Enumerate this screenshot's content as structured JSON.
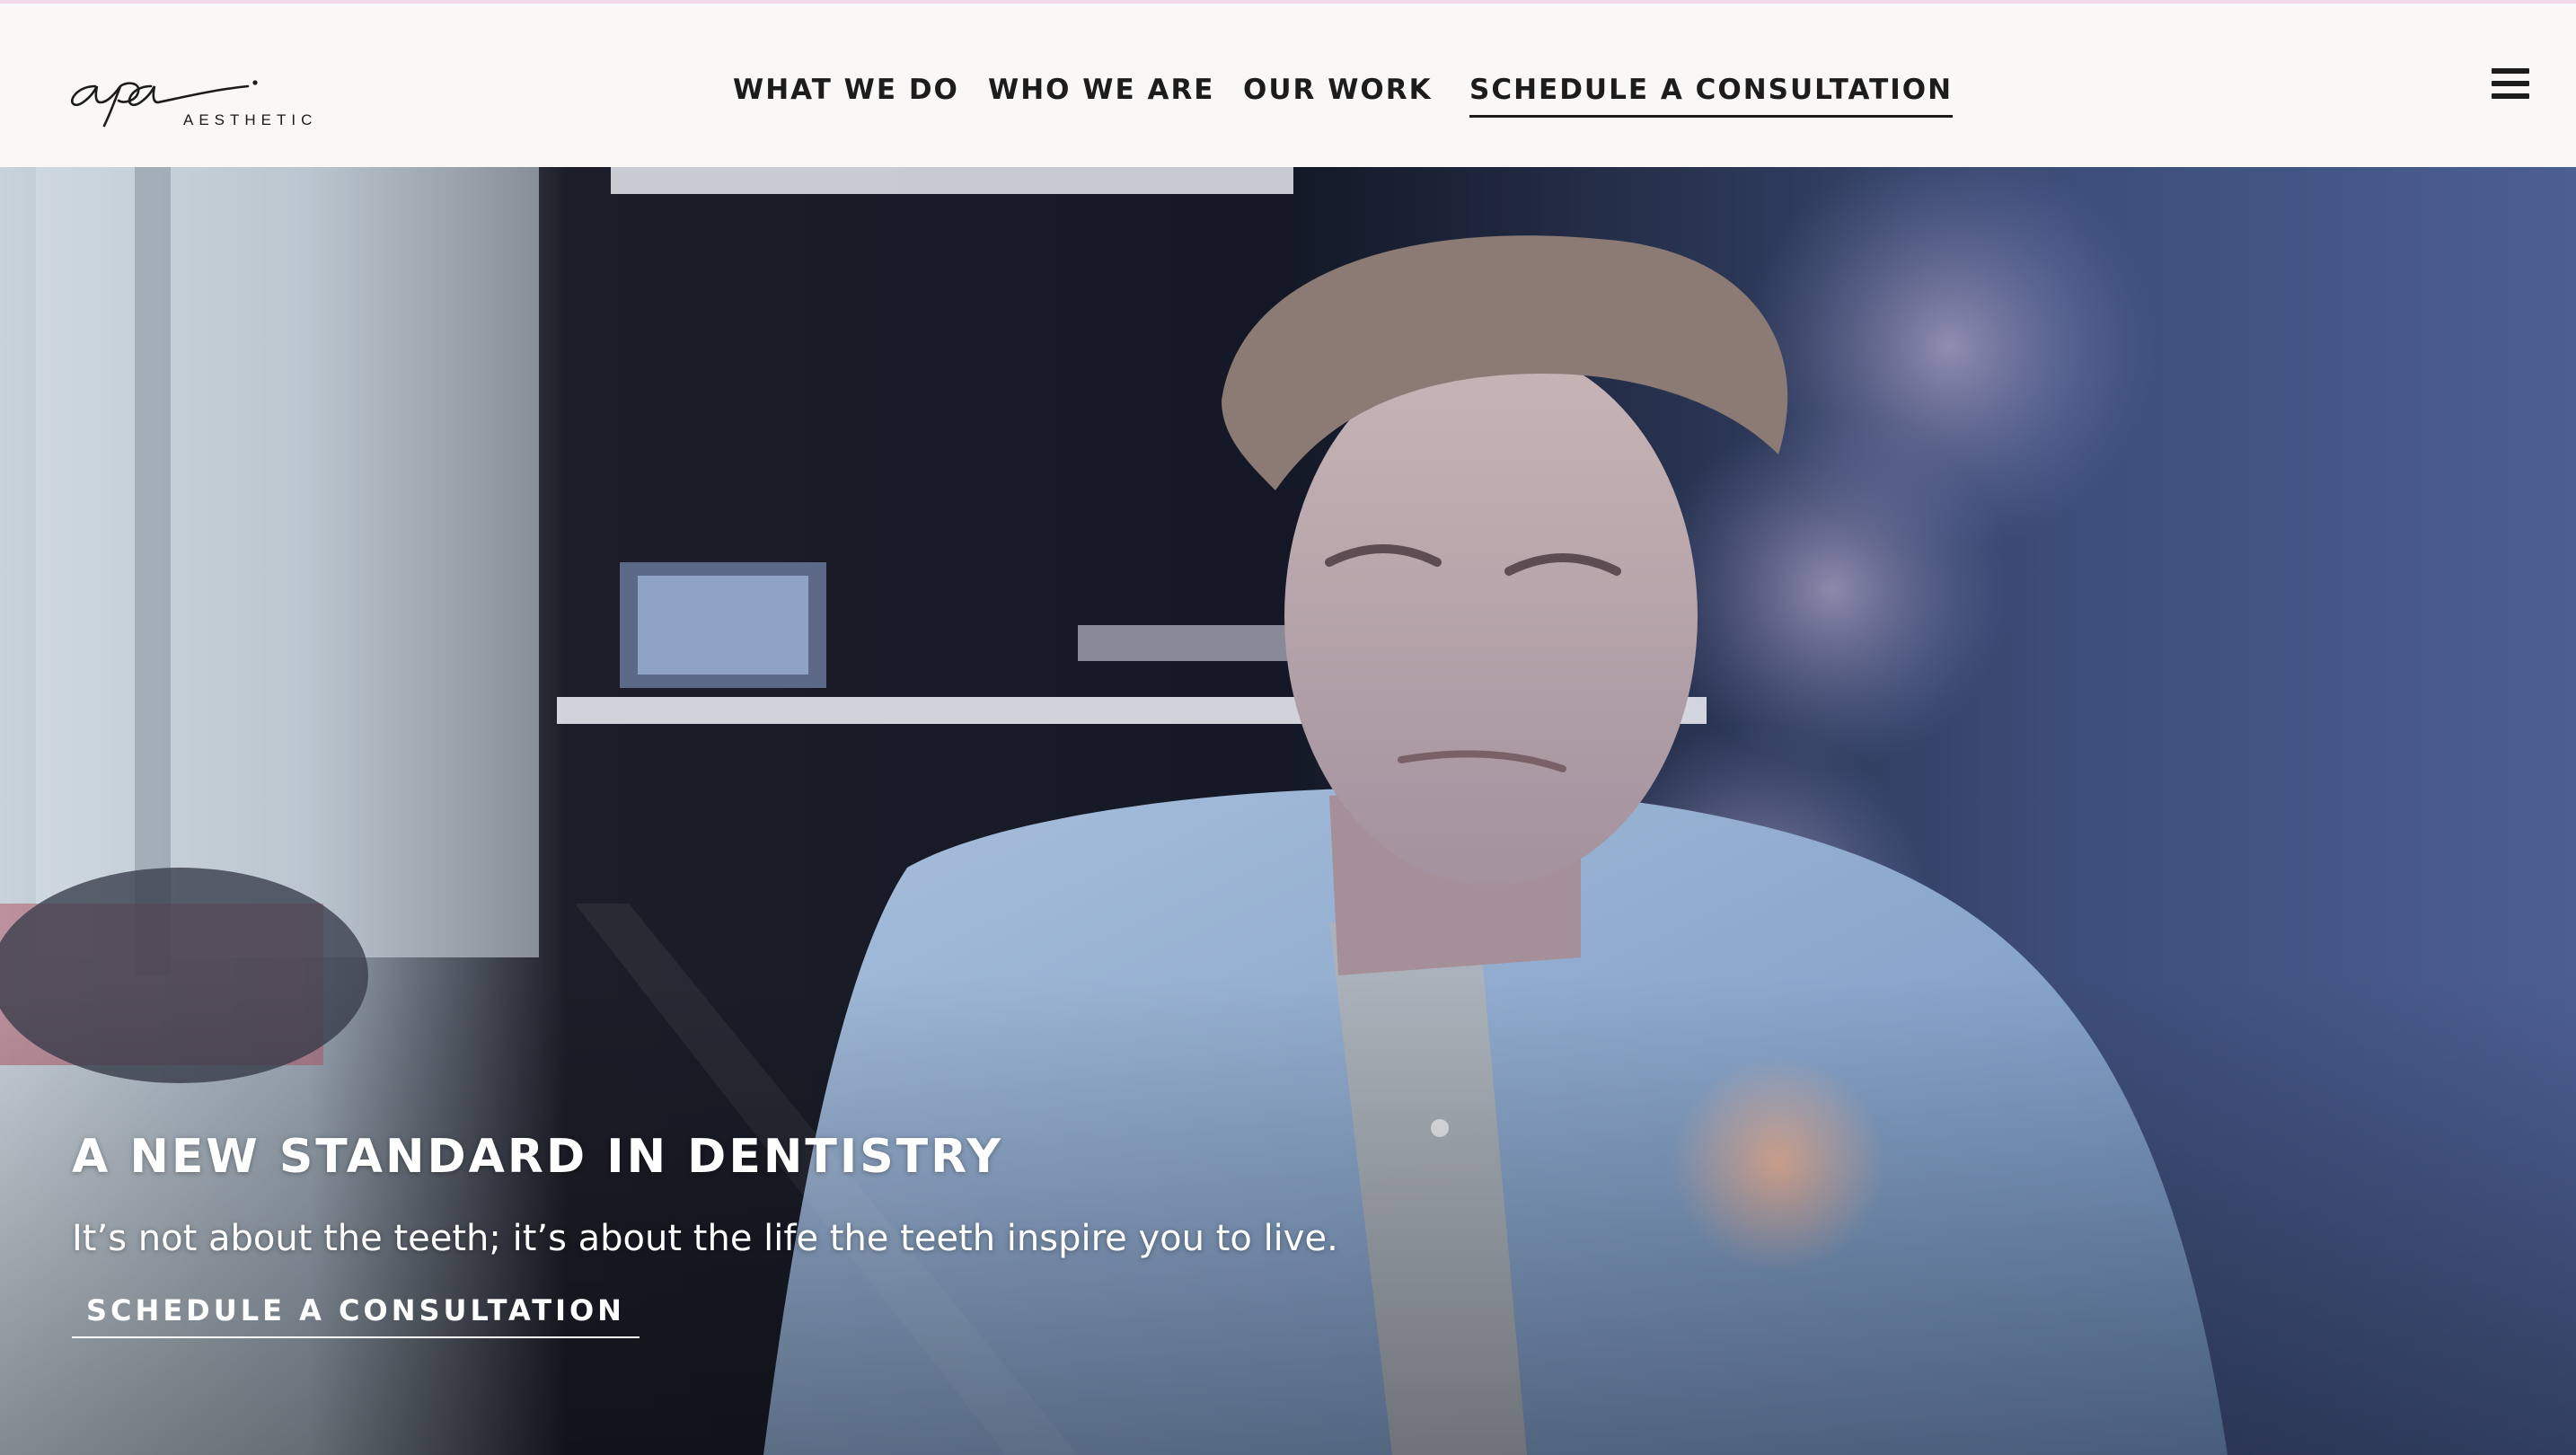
{
  "header": {
    "logo": {
      "wordmark": "apa.",
      "subtitle": "AESTHETIC"
    },
    "nav": [
      {
        "label": "WHAT WE DO"
      },
      {
        "label": "WHO WE ARE"
      },
      {
        "label": "OUR WORK"
      },
      {
        "label": "SCHEDULE A CONSULTATION",
        "active": true
      }
    ],
    "menu_icon": "hamburger-menu-icon"
  },
  "hero": {
    "headline": "A NEW STANDARD IN DENTISTRY",
    "subheadline": "It’s not about the teeth; it’s about the life the teeth inspire you to live.",
    "cta_label": "SCHEDULE A CONSULTATION"
  },
  "colors": {
    "header_bg": "#f9f8f6",
    "text_dark": "#1c1c1c",
    "hero_text": "#ffffff",
    "top_accent": "#f3d7ea"
  }
}
